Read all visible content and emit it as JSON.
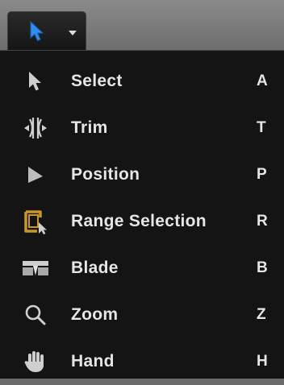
{
  "toolbar": {
    "selected_tool_icon": "blue-arrow-icon",
    "dropdown_icon": "chevron-down-icon"
  },
  "colors": {
    "accent_blue": "#2f8cf0",
    "range_orange": "#c9962a",
    "menu_bg": "#141414",
    "text": "#e6e6e6"
  },
  "menu": {
    "items": [
      {
        "label": "Select",
        "key": "A",
        "icon": "arrow-icon"
      },
      {
        "label": "Trim",
        "key": "T",
        "icon": "trim-icon"
      },
      {
        "label": "Position",
        "key": "P",
        "icon": "position-icon"
      },
      {
        "label": "Range Selection",
        "key": "R",
        "icon": "range-selection-icon"
      },
      {
        "label": "Blade",
        "key": "B",
        "icon": "blade-icon"
      },
      {
        "label": "Zoom",
        "key": "Z",
        "icon": "magnifier-icon"
      },
      {
        "label": "Hand",
        "key": "H",
        "icon": "hand-icon"
      }
    ]
  }
}
